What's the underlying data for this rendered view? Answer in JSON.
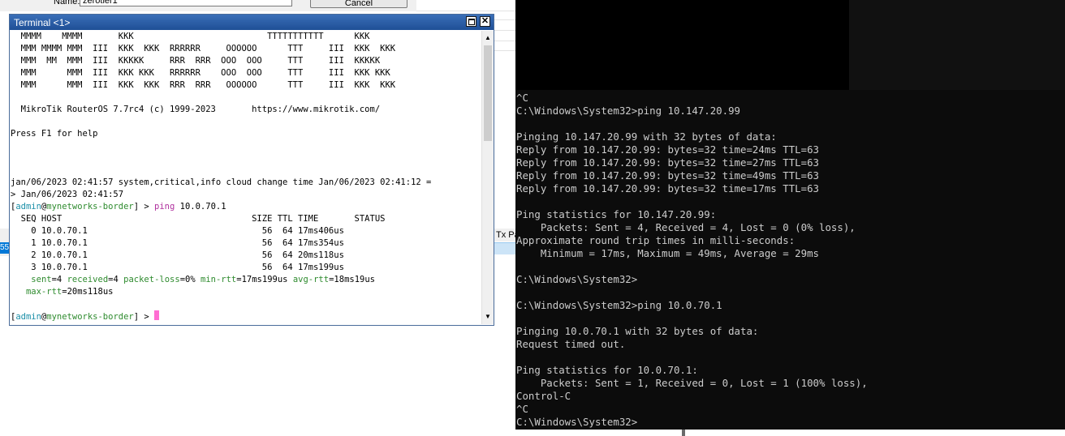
{
  "background_window": {
    "name_label": "Name:",
    "name_value": "zerotier1",
    "cancel_label": "Cancel",
    "tab_fragment": "Tx Pac",
    "left_fragment": "55"
  },
  "terminal": {
    "title": "Terminal <1>",
    "buttons": {
      "maximize": "□",
      "close": "✕"
    },
    "banner": [
      "  MMMM    MMMM       KKK                          TTTTTTTTTTT      KKK",
      "  MMM MMMM MMM  III  KKK  KKK  RRRRRR     OOOOOO      TTT     III  KKK  KKK",
      "  MMM  MM  MMM  III  KKKKK     RRR  RRR  OOO  OOO     TTT     III  KKKKK",
      "  MMM      MMM  III  KKK KKK   RRRRRR    OOO  OOO     TTT     III  KKK KKK",
      "  MMM      MMM  III  KKK  KKK  RRR  RRR   OOOOOO      TTT     III  KKK  KKK"
    ],
    "version_line": "  MikroTik RouterOS 7.7rc4 (c) 1999-2023       https://www.mikrotik.com/",
    "help_line": "Press F1 for help",
    "log_line_1": "jan/06/2023 02:41:57 system,critical,info cloud change time Jan/06/2023 02:41:12 =",
    "log_line_2": "> Jan/06/2023 02:41:57",
    "prompt": {
      "open": "[",
      "user": "admin",
      "at": "@",
      "host": "mynetworks-border",
      "close": "] > ",
      "command": "ping",
      "arg": " 10.0.70.1"
    },
    "ping_header": "  SEQ HOST                                     SIZE TTL TIME       STATUS",
    "ping_rows": [
      "    0 10.0.70.1                                  56  64 17ms406us",
      "    1 10.0.70.1                                  56  64 17ms354us",
      "    2 10.0.70.1                                  56  64 20ms118us",
      "    3 10.0.70.1                                  56  64 17ms199us"
    ],
    "stats": {
      "sent_key": "sent",
      "sent_val": "4",
      "received_key": "received",
      "received_val": "4",
      "loss_key": "packet-loss",
      "loss_val": "0%",
      "min_key": "min-rtt",
      "min_val": "17ms199us",
      "avg_key": "avg-rtt",
      "avg_val": "18ms19us",
      "max_key": "max-rtt",
      "max_val": "20ms118us"
    },
    "cursor_color": "#ff6ed2"
  },
  "cmd": {
    "lines": [
      "^C",
      "C:\\Windows\\System32>ping 10.147.20.99",
      "",
      "Pinging 10.147.20.99 with 32 bytes of data:",
      "Reply from 10.147.20.99: bytes=32 time=24ms TTL=63",
      "Reply from 10.147.20.99: bytes=32 time=27ms TTL=63",
      "Reply from 10.147.20.99: bytes=32 time=49ms TTL=63",
      "Reply from 10.147.20.99: bytes=32 time=17ms TTL=63",
      "",
      "Ping statistics for 10.147.20.99:",
      "    Packets: Sent = 4, Received = 4, Lost = 0 (0% loss),",
      "Approximate round trip times in milli-seconds:",
      "    Minimum = 17ms, Maximum = 49ms, Average = 29ms",
      "",
      "C:\\Windows\\System32>",
      "",
      "C:\\Windows\\System32>ping 10.0.70.1",
      "",
      "Pinging 10.0.70.1 with 32 bytes of data:",
      "Request timed out.",
      "",
      "Ping statistics for 10.0.70.1:",
      "    Packets: Sent = 1, Received = 0, Lost = 1 (100% loss),",
      "Control-C",
      "^C",
      "C:\\Windows\\System32>"
    ]
  }
}
